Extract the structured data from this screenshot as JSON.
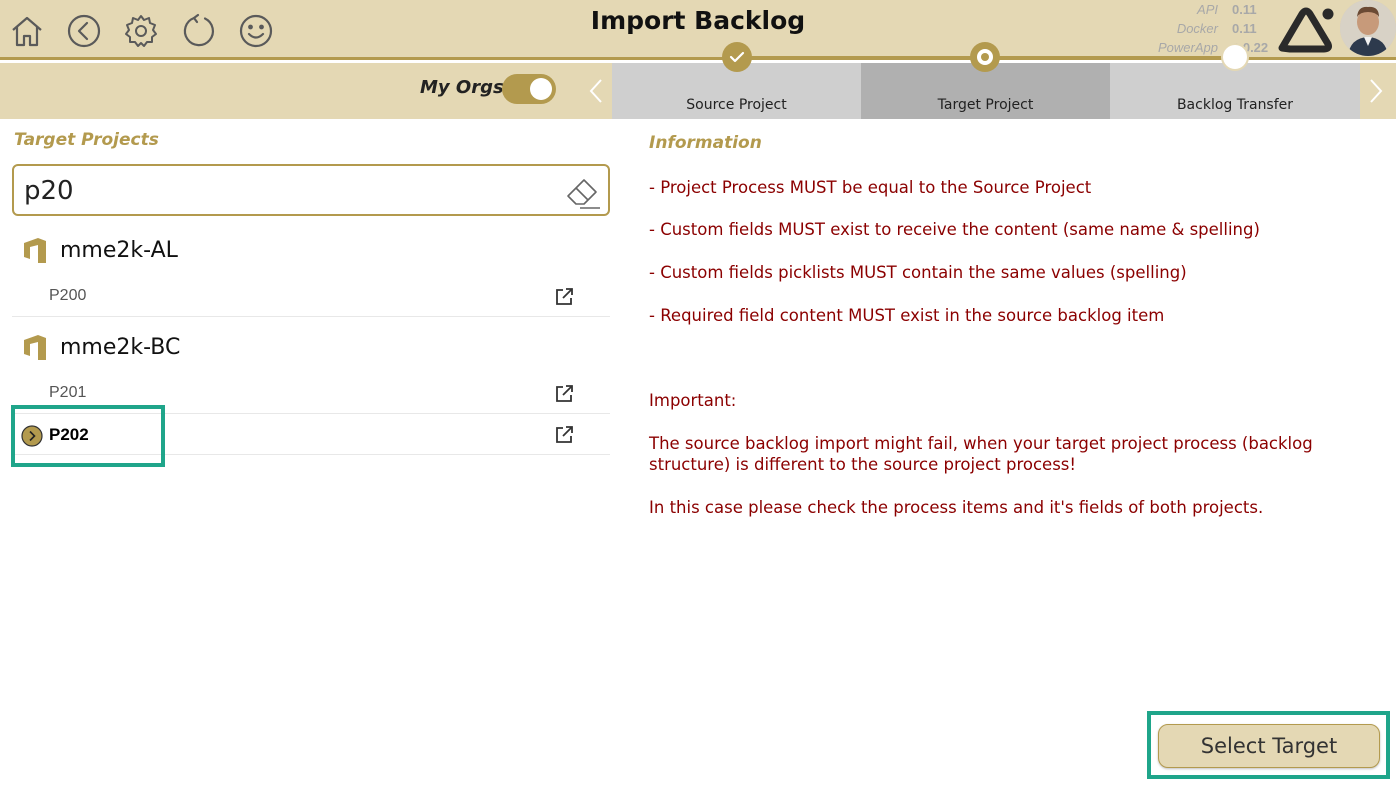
{
  "header": {
    "title": "Import Backlog",
    "nav_icons": [
      "home-icon",
      "back-icon",
      "settings-icon",
      "refresh-icon",
      "smiley-icon"
    ],
    "versions": [
      {
        "label": "API",
        "value": "0.11"
      },
      {
        "label": "Docker",
        "value": "0.11"
      },
      {
        "label": "PowerApp",
        "value": "2.0.22"
      }
    ]
  },
  "subheader": {
    "my_orgs_label": "My Orgs",
    "my_orgs_on": true,
    "steps": [
      {
        "label": "Source Project",
        "state": "done"
      },
      {
        "label": "Target Project",
        "state": "current"
      },
      {
        "label": "Backlog Transfer",
        "state": "pending"
      }
    ]
  },
  "left": {
    "title": "Target Projects",
    "search_value": "p20",
    "orgs": [
      {
        "name": "mme2k-AL",
        "projects": [
          {
            "name": "P200",
            "selected": false
          }
        ]
      },
      {
        "name": "mme2k-BC",
        "projects": [
          {
            "name": "P201",
            "selected": false
          },
          {
            "name": "P202",
            "selected": true
          }
        ]
      }
    ]
  },
  "right": {
    "info_title": "Information",
    "rules": [
      "- Project Process MUST be equal to the Source Project",
      "- Custom fields MUST exist to receive the content (same name & spelling)",
      "- Custom fields picklists MUST contain the same values (spelling)",
      "- Required field content MUST exist in the source backlog item"
    ],
    "important_label": "Important:",
    "important_text_1": "The source backlog import might fail, when your target project process (backlog structure) is different to the source project process!",
    "important_text_2": "In this case please check the process items and it's fields of both projects."
  },
  "actions": {
    "select_target_label": "Select Target"
  },
  "colors": {
    "header_bg": "#e4d8b4",
    "accent_gold": "#b39a4e",
    "info_text": "#8b0000",
    "highlight": "#1fa58a"
  }
}
